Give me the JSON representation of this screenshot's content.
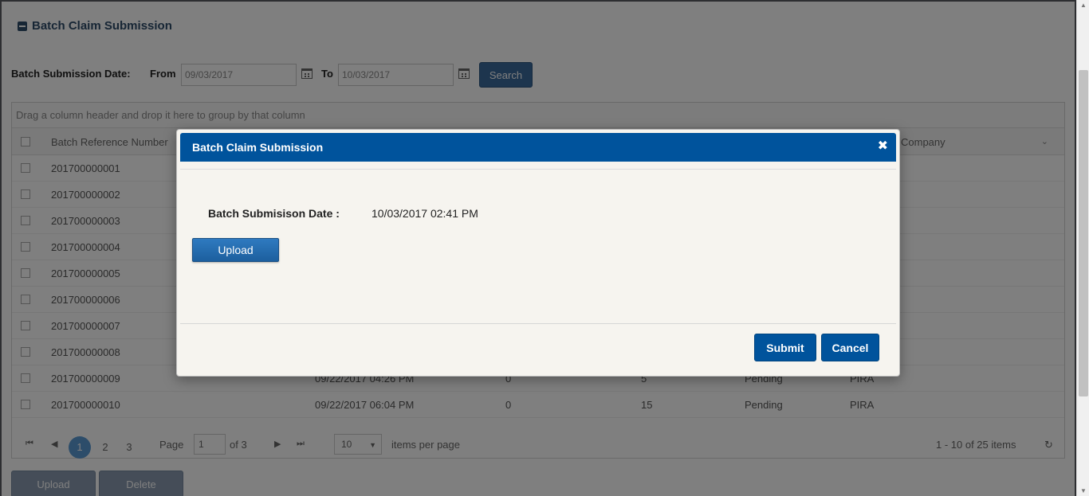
{
  "page": {
    "panel_title": "Batch Claim Submission",
    "filter": {
      "label": "Batch Submission Date:",
      "from_label": "From",
      "from_value": "09/03/2017",
      "to_label": "To",
      "to_value": "10/03/2017",
      "search_label": "Search"
    },
    "grid": {
      "group_hint": "Drag a column header and drop it here to group by that column",
      "columns": [
        "Batch Reference Number",
        "Company"
      ],
      "rows": [
        {
          "ref": "201700000001"
        },
        {
          "ref": "201700000002"
        },
        {
          "ref": "201700000003"
        },
        {
          "ref": "201700000004"
        },
        {
          "ref": "201700000005"
        },
        {
          "ref": "201700000006"
        },
        {
          "ref": "201700000007"
        },
        {
          "ref": "201700000008"
        },
        {
          "ref": "201700000009",
          "date": "09/22/2017 04:26 PM",
          "c3": "0",
          "c4": "5",
          "status": "Pending",
          "company": "PIRA"
        },
        {
          "ref": "201700000010",
          "date": "09/22/2017 06:04 PM",
          "c3": "0",
          "c4": "15",
          "status": "Pending",
          "company": "PIRA"
        }
      ]
    },
    "pager": {
      "pages": [
        "1",
        "2",
        "3"
      ],
      "current_page": "1",
      "page_label": "Page",
      "of_label": "of 3",
      "page_size": "10",
      "items_per_page": "items per page",
      "summary": "1 - 10 of 25 items"
    },
    "buttons": {
      "upload": "Upload",
      "delete": "Delete"
    }
  },
  "modal": {
    "title": "Batch Claim Submission",
    "close_glyph": "✖",
    "date_label": "Batch Submisison Date :",
    "date_value": "10/03/2017 02:41 PM",
    "upload_label": "Upload",
    "submit_label": "Submit",
    "cancel_label": "Cancel"
  },
  "colors": {
    "modal_header": "#00539c",
    "modal_body": "#f6f4ef",
    "overlay": "rgba(0,0,0,0.5)"
  }
}
